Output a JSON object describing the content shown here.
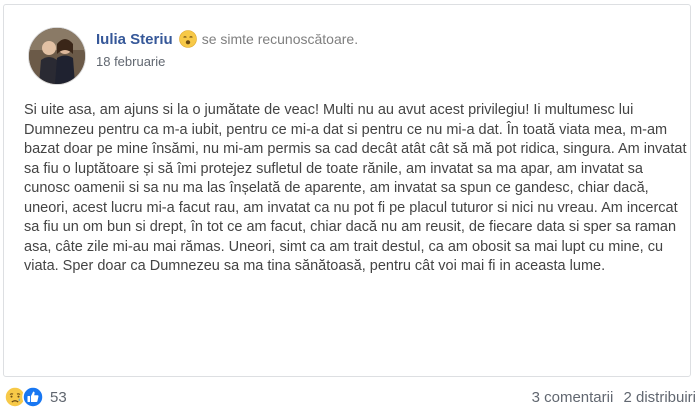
{
  "post": {
    "author": "Iulia Steriu",
    "feeling": "se simte recunoscătoare.",
    "date": "18 februarie",
    "paragraphs": [
      "Si uite asa, am ajuns si la o jumătate de veac! Multi nu au avut acest privilegiu! Ii multumesc lui Dumnezeu pentru ca m-a iubit, pentru ce mi-a dat si pentru ce nu mi-a dat. În toată viata mea, m-am bazat doar pe mine însămi, nu mi-am permis sa cad decât atât cât să mă pot ridica, singura. Am invatat sa fiu o luptătoare și să îmi protejez sufletul de toate rănile, am invatat sa ma apar, am invatat sa cunosc oamenii si sa nu ma las înșelată de aparente, am invatat sa spun ce gandesc, chiar dacă, uneori, acest lucru mi-a facut rau, am invatat ca nu pot fi pe placul tuturor si nici nu vreau. Am incercat sa fiu un om bun si drept, în tot ce am facut, chiar dacă nu am reusit, de fiecare data si sper sa raman asa, câte zile mi-au mai rămas. Uneori, simt ca am trait destul, ca am obosit sa mai lupt cu mine, cu viata. Sper doar ca Dumnezeu sa ma tina sănătoasă, pentru cât voi mai fi in aceasta lume."
    ],
    "feeling_icon": "relieved-face-icon"
  },
  "footer": {
    "reaction_icons": [
      "sad-face-icon",
      "like-icon"
    ],
    "reaction_count": "53",
    "comments": "3 comentarii",
    "shares": "2 distribuiri"
  },
  "colors": {
    "author": "#365899",
    "like_blue": "#1877f2",
    "emoji_yellow": "#f7c948"
  }
}
